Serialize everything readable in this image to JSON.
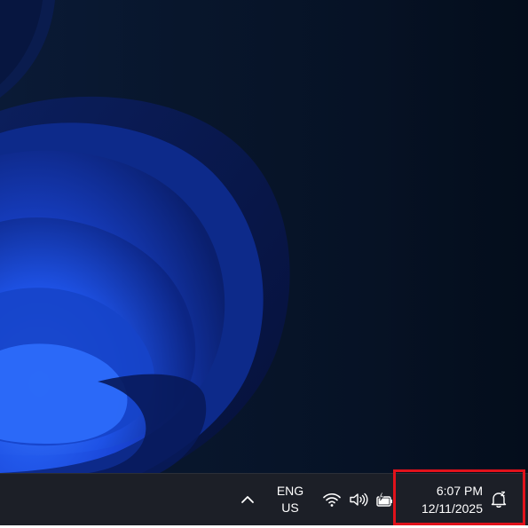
{
  "taskbar": {
    "overflow_icon": "chevron-up-icon",
    "language": {
      "line1": "ENG",
      "line2": "US"
    },
    "tray_icons": [
      "wifi-icon",
      "speaker-icon",
      "battery-charging-icon"
    ],
    "clock": {
      "time": "6:07 PM",
      "date": "12/11/2025"
    },
    "notification_icon": "notification-bell-icon"
  },
  "highlight": {
    "color": "#e0121b",
    "target": "clock-and-notifications"
  },
  "wallpaper": {
    "accent": "#1f4fe0",
    "background": "#061225"
  }
}
